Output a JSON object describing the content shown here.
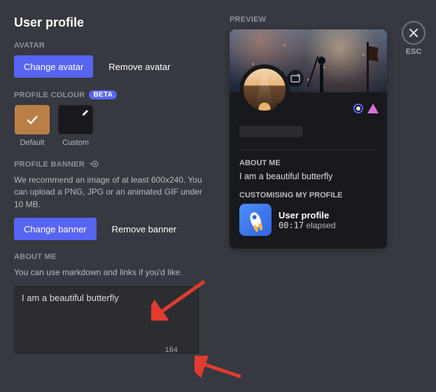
{
  "title": "User profile",
  "close_label": "ESC",
  "avatar_section": {
    "label": "AVATAR",
    "change_btn": "Change avatar",
    "remove_btn": "Remove avatar"
  },
  "colour_section": {
    "label": "PROFILE COLOUR",
    "beta": "BETA",
    "default_label": "Default",
    "custom_label": "Custom",
    "default_hex": "#b97f47"
  },
  "banner_section": {
    "label": "PROFILE BANNER",
    "helper": "We recommend an image of at least 600x240. You can upload a PNG, JPG or an animated GIF under 10 MB.",
    "change_btn": "Change banner",
    "remove_btn": "Remove banner"
  },
  "about_section": {
    "label": "ABOUT ME",
    "helper": "You can use markdown and links if you'd like.",
    "value": "I am a beautiful butterfly",
    "chars_remaining": "164"
  },
  "preview": {
    "label": "PREVIEW",
    "about_label": "ABOUT ME",
    "about_text": "I am a beautiful butterfly",
    "customising_label": "CUSTOMISING MY PROFILE",
    "activity_title": "User profile",
    "activity_elapsed_time": "00:17",
    "activity_elapsed_suffix": " elapsed"
  }
}
